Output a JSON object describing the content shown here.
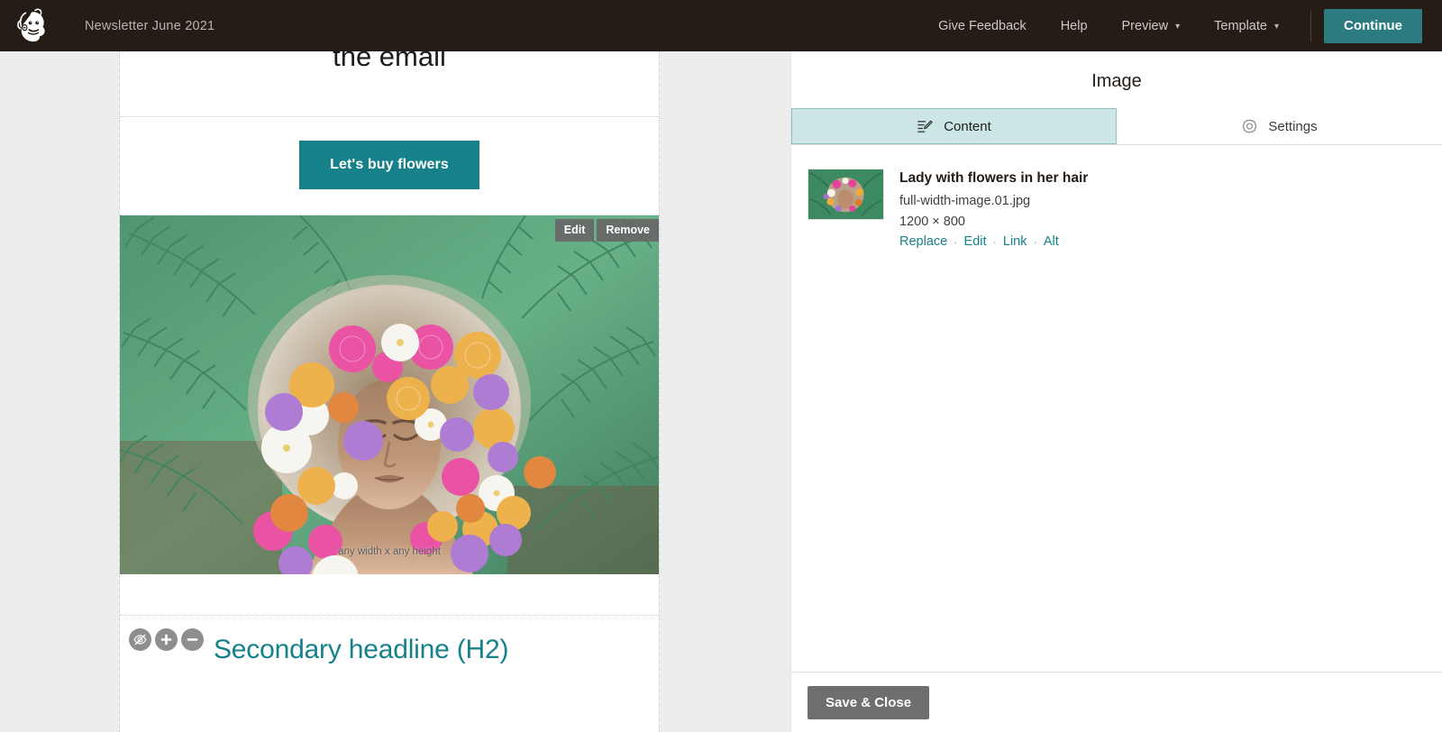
{
  "topbar": {
    "logo_icon": "mailchimp-freddie-logo",
    "campaign_title": "Newsletter June 2021",
    "nav": [
      {
        "label": "Give Feedback",
        "icon": null,
        "name": "give-feedback"
      },
      {
        "label": "Help",
        "icon": null,
        "name": "help"
      },
      {
        "label": "Preview",
        "icon": "chevron-down-icon",
        "name": "preview"
      },
      {
        "label": "Template",
        "icon": "chevron-down-icon",
        "name": "template"
      }
    ],
    "caret_glyph": "▾",
    "continue_label": "Continue",
    "bg_color": "#241c15",
    "accent_color": "#2c7b80"
  },
  "canvas": {
    "background_color": "#eceeed",
    "text_block": {
      "headline_visible_line": "the email"
    },
    "button_block": {
      "cta_label": "Let's buy flowers",
      "cta_color": "#17818a"
    },
    "image_block": {
      "caption": "any width x any height",
      "overlay_buttons": [
        {
          "label": "Edit",
          "name": "image-edit-button"
        },
        {
          "label": "Remove",
          "name": "image-remove-button"
        }
      ]
    },
    "h2_block": {
      "text": "Secondary headline (H2)",
      "text_color": "#17818a",
      "tools": [
        {
          "icon": "eye-slash-icon",
          "name": "toggle-visibility-button"
        },
        {
          "icon": "plus-icon",
          "name": "add-block-button"
        },
        {
          "icon": "minus-icon",
          "name": "remove-block-button"
        }
      ]
    }
  },
  "panel": {
    "title": "Image",
    "tabs": [
      {
        "label": "Content",
        "icon": "edit-pencil-icon",
        "active": true,
        "name": "tab-content"
      },
      {
        "label": "Settings",
        "icon": "gear-icon",
        "active": false,
        "name": "tab-settings"
      }
    ],
    "active_tab_bg": "#cce5e5",
    "media": {
      "thumbnail_icon": "image-thumbnail",
      "alt_title": "Lady with flowers in her hair",
      "filename": "full-width-image.01.jpg",
      "dimensions": "1200 × 800",
      "actions": [
        {
          "label": "Replace",
          "name": "replace-link"
        },
        {
          "label": "Edit",
          "name": "edit-link"
        },
        {
          "label": "Link",
          "name": "link-link"
        },
        {
          "label": "Alt",
          "name": "alt-link"
        }
      ],
      "action_separator": "·",
      "link_color": "#17818a"
    },
    "footer": {
      "save_close_label": "Save & Close"
    }
  }
}
